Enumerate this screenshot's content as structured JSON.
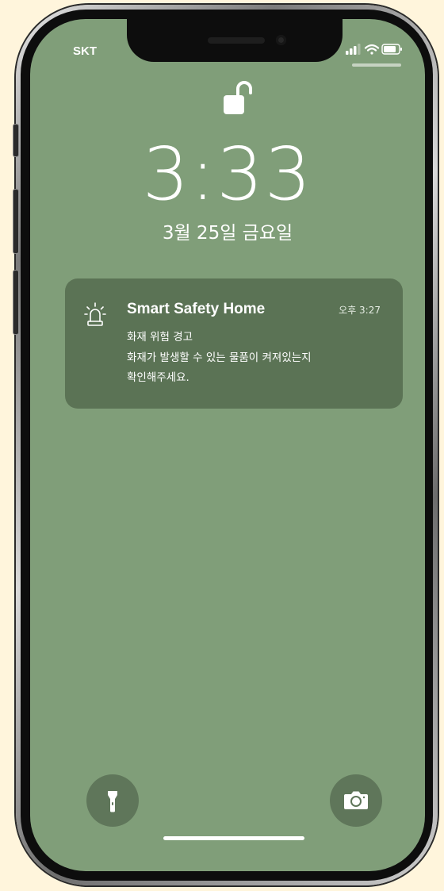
{
  "status_bar": {
    "carrier": "SKT",
    "signal_icon": "cellular-signal-icon",
    "wifi_icon": "wifi-icon",
    "battery_icon": "battery-icon"
  },
  "lock_screen": {
    "lock_icon": "unlocked-padlock-icon",
    "time": "3:33",
    "date": "3월 25일 금요일"
  },
  "notification": {
    "app_icon": "siren-alarm-icon",
    "app_name": "Smart Safety Home",
    "time": "오후 3:27",
    "title": "화재 위험 경고",
    "body_line1": "화재가 발생할 수 있는 물품이 켜져있는지",
    "body_line2": "확인해주세요."
  },
  "quick_actions": {
    "flashlight_icon": "flashlight-icon",
    "camera_icon": "camera-icon"
  },
  "colors": {
    "wallpaper": "#809e79",
    "notification_bg": "#5b7355",
    "quick_button_bg": "#5f765a",
    "page_bg": "#fff5dc"
  }
}
